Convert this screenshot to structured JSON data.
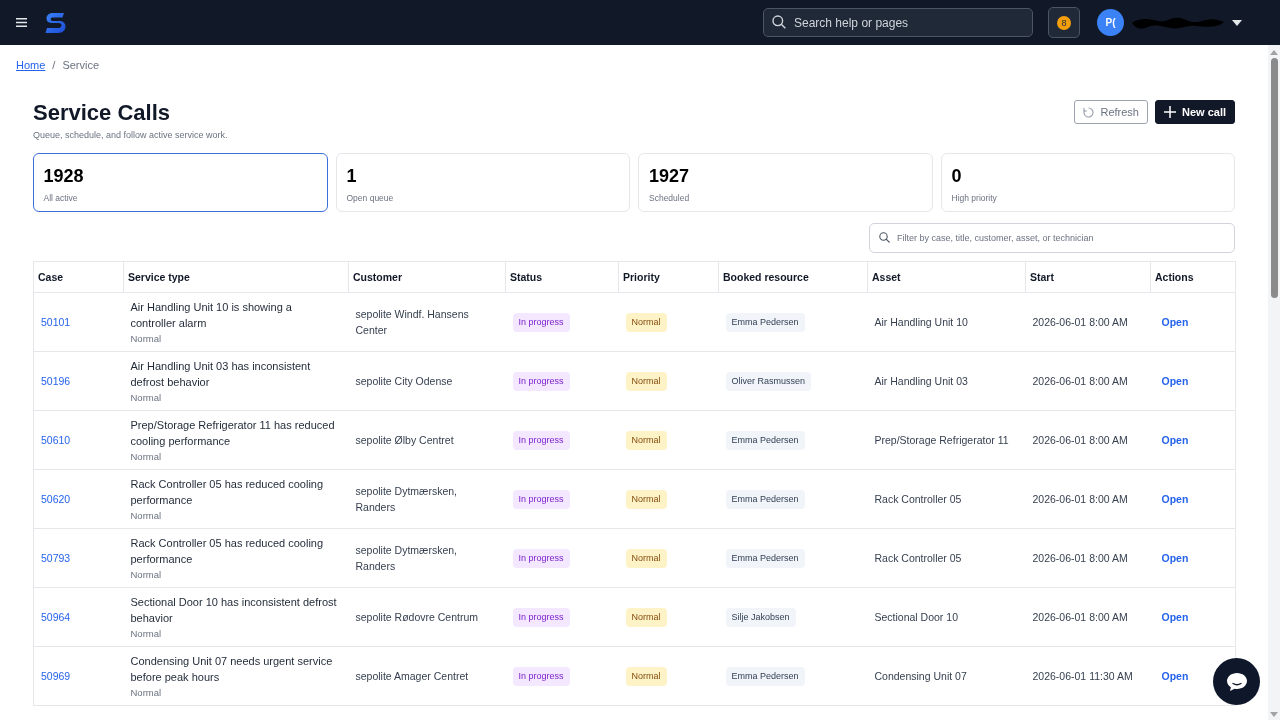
{
  "header": {
    "search": {
      "placeholder": "Search help or pages"
    },
    "notifications": {
      "count": "8"
    },
    "user": {
      "initials": "P("
    }
  },
  "breadcrumb": {
    "separator": "/",
    "items": [
      {
        "label": "Home",
        "kind": "link"
      },
      {
        "label": "Service",
        "kind": "current"
      }
    ]
  },
  "page": {
    "title": "Service Calls",
    "subtitle": "Queue, schedule, and follow active service work."
  },
  "actions": [
    {
      "label": "Refresh",
      "kind": "secondary"
    },
    {
      "label": "New call",
      "kind": "primary"
    }
  ],
  "stats": [
    {
      "value": "1928",
      "label": "All active",
      "selected": true
    },
    {
      "value": "1",
      "label": "Open queue",
      "selected": false
    },
    {
      "value": "1927",
      "label": "Scheduled",
      "selected": false
    },
    {
      "value": "0",
      "label": "High priority",
      "selected": false
    }
  ],
  "filter": {
    "placeholder": "Filter by case, title, customer, asset, or technician"
  },
  "table": {
    "columns": [
      "Case",
      "Service type",
      "Customer",
      "Status",
      "Priority",
      "Booked resource",
      "Asset",
      "Start",
      "Actions"
    ],
    "rows": [
      {
        "case": "50101",
        "title": "Air Handling Unit 10 is showing a controller alarm",
        "priority_note": "Normal",
        "customer": "sepolite Windf. Hansens Center",
        "status": "In progress",
        "priority": "Normal",
        "resource": "Emma Pedersen",
        "asset": "Air Handling Unit 10",
        "start": "2026-06-01 8:00 AM",
        "action": "Open"
      },
      {
        "case": "50196",
        "title": "Air Handling Unit 03 has inconsistent defrost behavior",
        "priority_note": "Normal",
        "customer": "sepolite City Odense",
        "status": "In progress",
        "priority": "Normal",
        "resource": "Oliver Rasmussen",
        "asset": "Air Handling Unit 03",
        "start": "2026-06-01 8:00 AM",
        "action": "Open"
      },
      {
        "case": "50610",
        "title": "Prep/Storage Refrigerator 11 has reduced cooling performance",
        "priority_note": "Normal",
        "customer": "sepolite Ølby Centret",
        "status": "In progress",
        "priority": "Normal",
        "resource": "Emma Pedersen",
        "asset": "Prep/Storage Refrigerator 11",
        "start": "2026-06-01 8:00 AM",
        "action": "Open"
      },
      {
        "case": "50620",
        "title": "Rack Controller 05 has reduced cooling performance",
        "priority_note": "Normal",
        "customer": "sepolite Dytmærsken, Randers",
        "status": "In progress",
        "priority": "Normal",
        "resource": "Emma Pedersen",
        "asset": "Rack Controller 05",
        "start": "2026-06-01 8:00 AM",
        "action": "Open"
      },
      {
        "case": "50793",
        "title": "Rack Controller 05 has reduced cooling performance",
        "priority_note": "Normal",
        "customer": "sepolite Dytmærsken, Randers",
        "status": "In progress",
        "priority": "Normal",
        "resource": "Emma Pedersen",
        "asset": "Rack Controller 05",
        "start": "2026-06-01 8:00 AM",
        "action": "Open"
      },
      {
        "case": "50964",
        "title": "Sectional Door 10 has inconsistent defrost behavior",
        "priority_note": "Normal",
        "customer": "sepolite Rødovre Centrum",
        "status": "In progress",
        "priority": "Normal",
        "resource": "Silje Jakobsen",
        "asset": "Sectional Door 10",
        "start": "2026-06-01 8:00 AM",
        "action": "Open"
      },
      {
        "case": "50969",
        "title": "Condensing Unit 07 needs urgent service before peak hours",
        "priority_note": "Normal",
        "customer": "sepolite Amager Centret",
        "status": "In progress",
        "priority": "Normal",
        "resource": "Emma Pedersen",
        "asset": "Condensing Unit 07",
        "start": "2026-06-01 11:30 AM",
        "action": "Open"
      }
    ]
  }
}
